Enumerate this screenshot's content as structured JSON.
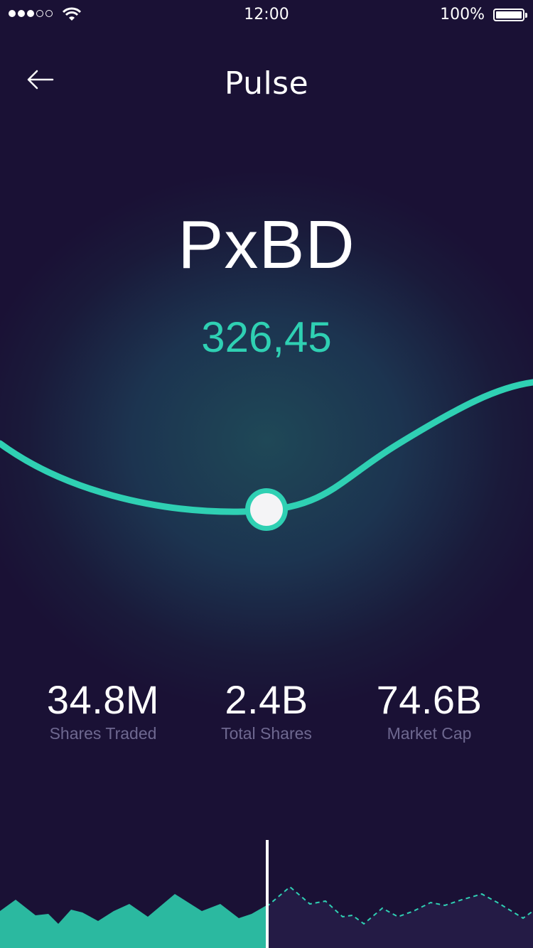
{
  "status_bar": {
    "time": "12:00",
    "battery": "100%",
    "signal_bars_filled": 3,
    "signal_bars_total": 5
  },
  "nav": {
    "back_icon": "arrow-left-icon",
    "title": "Pulse"
  },
  "stock": {
    "ticker": "PxBD",
    "price": "326,45"
  },
  "stats": [
    {
      "value": "34.8M",
      "label": "Shares Traded"
    },
    {
      "value": "2.4B",
      "label": "Total Shares"
    },
    {
      "value": "74.6B",
      "label": "Market Cap"
    }
  ],
  "colors": {
    "background": "#1a1135",
    "accent": "#2fd0b3",
    "label": "#6e6890",
    "text": "#ffffff"
  }
}
